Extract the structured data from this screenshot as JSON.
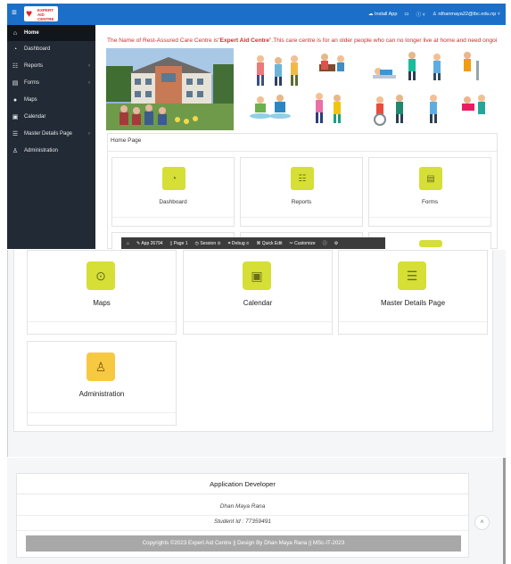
{
  "header": {
    "logo_line1": "EXPERT",
    "logo_line2": "AID",
    "logo_line3": "CENTRE",
    "install_label": "Install App",
    "user_email": "rdhanmaya22@tbc.edu.np"
  },
  "sidebar": {
    "items": [
      {
        "label": "Home",
        "icon": "home-icon"
      },
      {
        "label": "Dashboard",
        "icon": "dashboard-icon"
      },
      {
        "label": "Reports",
        "icon": "reports-icon"
      },
      {
        "label": "Forms",
        "icon": "forms-icon"
      },
      {
        "label": "Maps",
        "icon": "map-pin-icon"
      },
      {
        "label": "Calendar",
        "icon": "calendar-icon"
      },
      {
        "label": "Master Details Page",
        "icon": "master-details-icon"
      },
      {
        "label": "Administration",
        "icon": "admin-user-icon"
      }
    ]
  },
  "banner": {
    "text_before": "The Name of Rest-Assured Care Centre is\"",
    "text_bold": "Expert Aid Centre",
    "text_after": "\".This care centre is for an older people who can no longer live at home and need ongoi"
  },
  "home_region": {
    "title": "Home Page",
    "cards_top": [
      {
        "label": "Dashboard",
        "icon": "gauge-icon"
      },
      {
        "label": "Reports",
        "icon": "report-list-icon"
      },
      {
        "label": "Forms",
        "icon": "form-card-icon"
      }
    ],
    "cards_mid": [
      {
        "label": "Maps",
        "icon": "map-pin-icon"
      },
      {
        "label": "Calendar",
        "icon": "calendar-clock-icon"
      },
      {
        "label": "Master Details Page",
        "icon": "master-detail-icon"
      }
    ],
    "card_admin": {
      "label": "Administration",
      "icon": "user-key-icon"
    }
  },
  "devbar": {
    "app": "App 26794",
    "page": "Page 1",
    "session": "Session",
    "debug": "Debug",
    "quick_edit": "Quick Edit",
    "customize": "Customize"
  },
  "footer": {
    "title": "Application Developer",
    "name": "Dhan Maya Rana",
    "student_id": "Student Id : 77359491",
    "copyright": "Copyrights ©2023 Expert Aid Centre || Design By Dhan Maya Rana || MSc-IT-2023"
  }
}
